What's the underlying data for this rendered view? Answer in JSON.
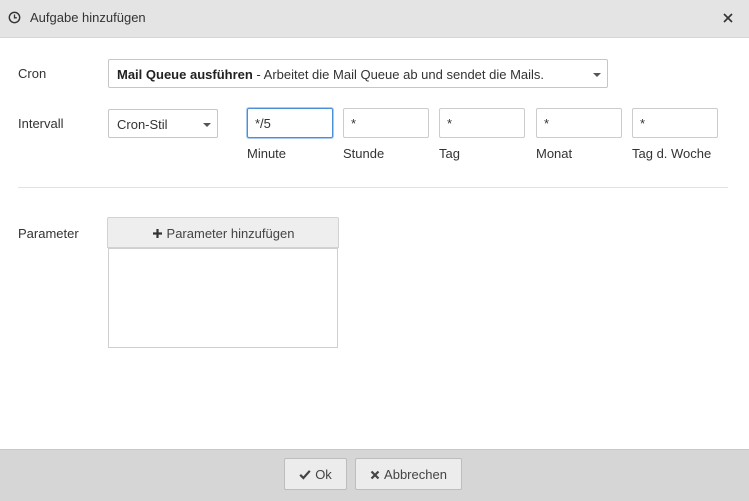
{
  "dialog": {
    "title": "Aufgabe hinzufügen",
    "title_icon": "clock-icon",
    "close_icon": "close-icon"
  },
  "cron": {
    "label": "Cron",
    "selected_bold": "Mail Queue ausführen",
    "selected_desc": " - Arbeitet die Mail Queue ab und sendet die Mails."
  },
  "interval": {
    "label": "Intervall",
    "style_value": "Cron-Stil",
    "fields": [
      {
        "label": "Minute",
        "value": "*/5"
      },
      {
        "label": "Stunde",
        "value": "*"
      },
      {
        "label": "Tag",
        "value": "*"
      },
      {
        "label": "Monat",
        "value": "*"
      },
      {
        "label": "Tag d. Woche",
        "value": "*"
      }
    ]
  },
  "parameter": {
    "label": "Parameter",
    "add_button": "Parameter hinzufügen",
    "add_icon": "plus-icon"
  },
  "footer": {
    "ok_label": "Ok",
    "ok_icon": "check-icon",
    "cancel_label": "Abbrechen",
    "cancel_icon": "x-icon"
  },
  "colors": {
    "focus_border": "#4a90d9",
    "titlebar_bg": "#e4e4e4",
    "footer_bg": "#d6d6d6"
  }
}
